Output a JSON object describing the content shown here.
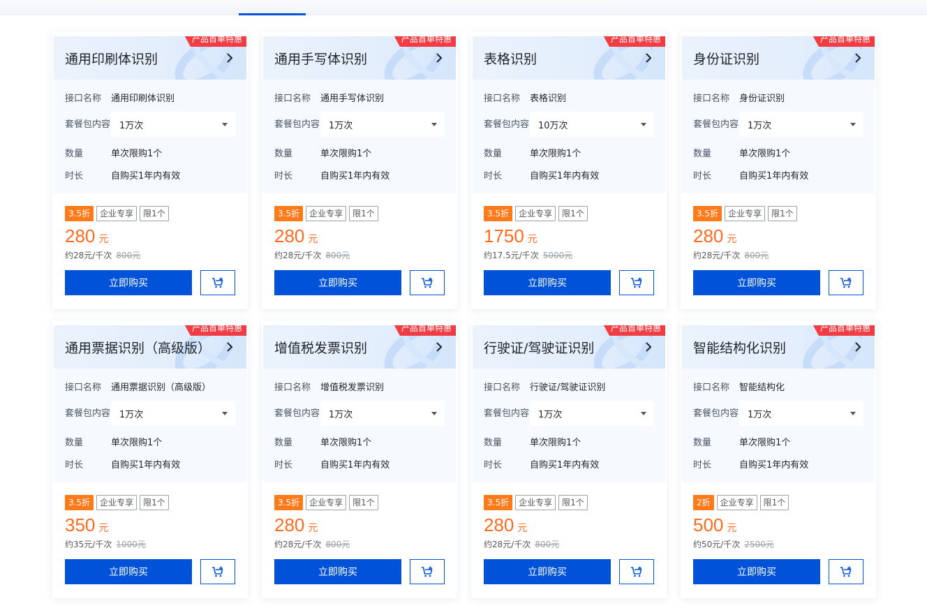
{
  "colors": {
    "accent": "#0052d9",
    "price": "#ff6a1f",
    "ribbon": "#f23c44",
    "discount": "#ff7a1a"
  },
  "labels": {
    "ribbon": "产品首单特惠",
    "name": "接口名称",
    "package": "套餐包内容",
    "quantity": "数量",
    "duration": "时长",
    "tag_enterprise": "企业专享",
    "tag_limit": "限1个",
    "currency": "元",
    "buy": "立即购买"
  },
  "cards": [
    {
      "title": "通用印刷体识别",
      "api": "通用印刷体识别",
      "package": "1万次",
      "quantity": "单次限购1个",
      "duration": "自购买1年内有效",
      "discount": "3.5折",
      "price": "280",
      "per": "约28元/千次",
      "original": "800元"
    },
    {
      "title": "通用手写体识别",
      "api": "通用手写体识别",
      "package": "1万次",
      "quantity": "单次限购1个",
      "duration": "自购买1年内有效",
      "discount": "3.5折",
      "price": "280",
      "per": "约28元/千次",
      "original": "800元"
    },
    {
      "title": "表格识别",
      "api": "表格识别",
      "package": "10万次",
      "quantity": "单次限购1个",
      "duration": "自购买1年内有效",
      "discount": "3.5折",
      "price": "1750",
      "per": "约17.5元/千次",
      "original": "5000元"
    },
    {
      "title": "身份证识别",
      "api": "身份证识别",
      "package": "1万次",
      "quantity": "单次限购1个",
      "duration": "自购买1年内有效",
      "discount": "3.5折",
      "price": "280",
      "per": "约28元/千次",
      "original": "800元"
    },
    {
      "title": "通用票据识别（高级版）",
      "api": "通用票据识别（高级版）",
      "package": "1万次",
      "quantity": "单次限购1个",
      "duration": "自购买1年内有效",
      "discount": "3.5折",
      "price": "350",
      "per": "约35元/千次",
      "original": "1000元"
    },
    {
      "title": "增值税发票识别",
      "api": "增值税发票识别",
      "package": "1万次",
      "quantity": "单次限购1个",
      "duration": "自购买1年内有效",
      "discount": "3.5折",
      "price": "280",
      "per": "约28元/千次",
      "original": "800元"
    },
    {
      "title": "行驶证/驾驶证识别",
      "api": "行驶证/驾驶证识别",
      "package": "1万次",
      "quantity": "单次限购1个",
      "duration": "自购买1年内有效",
      "discount": "3.5折",
      "price": "280",
      "per": "约28元/千次",
      "original": "800元"
    },
    {
      "title": "智能结构化识别",
      "api": "智能结构化",
      "package": "1万次",
      "quantity": "单次限购1个",
      "duration": "自购买1年内有效",
      "discount": "2折",
      "price": "500",
      "per": "约50元/千次",
      "original": "2500元"
    }
  ]
}
